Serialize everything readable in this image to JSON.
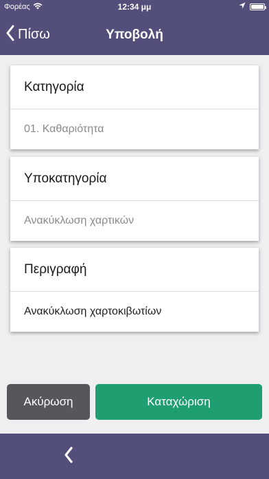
{
  "status_bar": {
    "carrier": "Φορέας",
    "time": "12:34 μμ"
  },
  "nav": {
    "back_label": "Πίσω",
    "title": "Υποβολή"
  },
  "form": {
    "category": {
      "label": "Κατηγορία",
      "value": "01. Καθαριότητα"
    },
    "subcategory": {
      "label": "Υποκατηγορία",
      "value": "Ανακύκλωση χαρτικών"
    },
    "description": {
      "label": "Περιγραφή",
      "value": "Ανακύκλωση χαρτοκιβωτίων"
    }
  },
  "actions": {
    "cancel_label": "Ακύρωση",
    "submit_label": "Καταχώριση"
  },
  "colors": {
    "nav_background": "#52507a",
    "submit": "#1f9f6f",
    "cancel": "#57565b",
    "page_background": "#efeff1"
  },
  "icons": [
    "wifi-icon",
    "location-arrow-icon",
    "battery-icon",
    "chevron-left-icon"
  ]
}
